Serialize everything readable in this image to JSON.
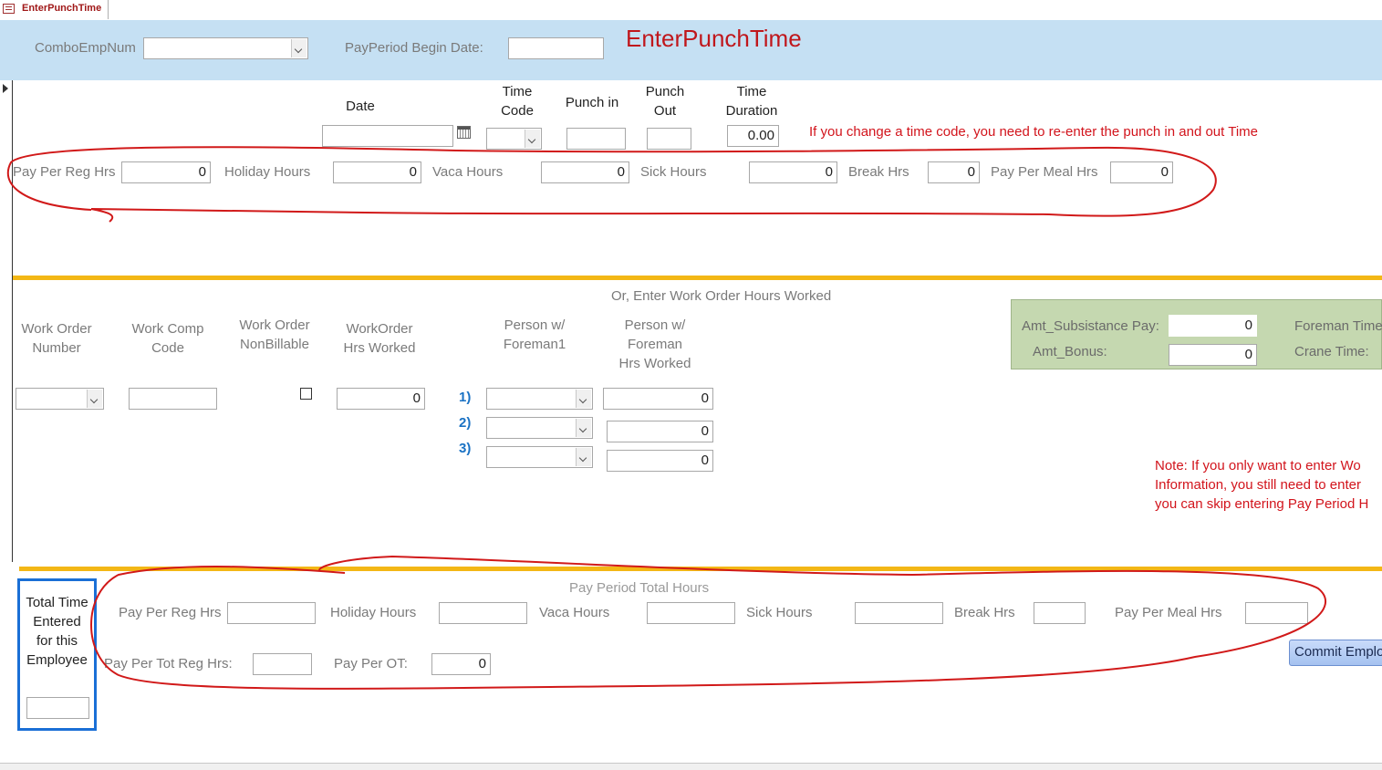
{
  "tab": {
    "label": "EnterPunchTime",
    "icon": "form-icon"
  },
  "header": {
    "combo_label": "ComboEmpNum",
    "combo_value": "",
    "payperiod_label": "PayPeriod Begin Date:",
    "payperiod_value": "",
    "title": "EnterPunchTime"
  },
  "punch": {
    "date_label": "Date",
    "timecode_label": "Time\nCode",
    "punchin_label": "Punch in",
    "punchout_label": "Punch\nOut",
    "duration_label": "Time\nDuration",
    "date_value": "",
    "punchin_value": "",
    "punchout_value": "",
    "duration_value": "0.00",
    "warning": "If you change a time code, you need to re-enter the punch in and out Time"
  },
  "hours_row": {
    "reg_label": "Pay Per Reg Hrs",
    "reg_value": "0",
    "holiday_label": "Holiday Hours",
    "holiday_value": "0",
    "vaca_label": "Vaca Hours",
    "vaca_value": "0",
    "sick_label": "Sick Hours",
    "sick_value": "0",
    "break_label": "Break Hrs",
    "break_value": "0",
    "meal_label": "Pay Per Meal Hrs",
    "meal_value": "0"
  },
  "workorder": {
    "section_title": "Or, Enter Work Order Hours Worked",
    "wo_number_label": "Work Order\nNumber",
    "comp_code_label": "Work Comp\nCode",
    "nonbillable_label": "Work Order\nNonBillable",
    "hrs_worked_label": "WorkOrder\nHrs Worked",
    "person_label": "Person w/\nForeman1",
    "person_hrs_label": "Person w/\nForeman\nHrs Worked",
    "comp_code_value": "",
    "hrs_worked_value": "0",
    "rows": [
      {
        "num": "1)",
        "hours": "0"
      },
      {
        "num": "2)",
        "hours": "0"
      },
      {
        "num": "3)",
        "hours": "0"
      }
    ]
  },
  "green_panel": {
    "subsistance_label": "Amt_Subsistance Pay:",
    "subsistance_value": "0",
    "bonus_label": "Amt_Bonus:",
    "bonus_value": "0",
    "foreman_label": "Foreman Time",
    "crane_label": "Crane Time:"
  },
  "note": {
    "line1": "Note: If you only want to enter Wo",
    "line2": "Information, you still need to enter",
    "line3": "you can skip entering Pay Period H"
  },
  "totals": {
    "section_title": "Pay Period Total Hours",
    "box_label": "Total Time\nEntered\nfor this\nEmployee",
    "box_value": "",
    "reg_label": "Pay Per Reg Hrs",
    "reg_value": "",
    "holiday_label": "Holiday Hours",
    "holiday_value": "",
    "vaca_label": "Vaca Hours",
    "vaca_value": "",
    "sick_label": "Sick Hours",
    "sick_value": "",
    "break_label": "Break Hrs",
    "break_value": "",
    "meal_label": "Pay Per Meal Hrs",
    "meal_value": "",
    "tot_reg_label": "Pay Per Tot Reg Hrs:",
    "tot_reg_value": "",
    "ot_label": "Pay Per OT:",
    "ot_value": "0"
  },
  "commit_button": "Commit Employee",
  "colors": {
    "header_bg": "#c5e0f3",
    "accent_red": "#c0171c",
    "orange_bar": "#f3b715",
    "green_panel": "#c5d8b0",
    "blue_border": "#1a6fd6"
  }
}
